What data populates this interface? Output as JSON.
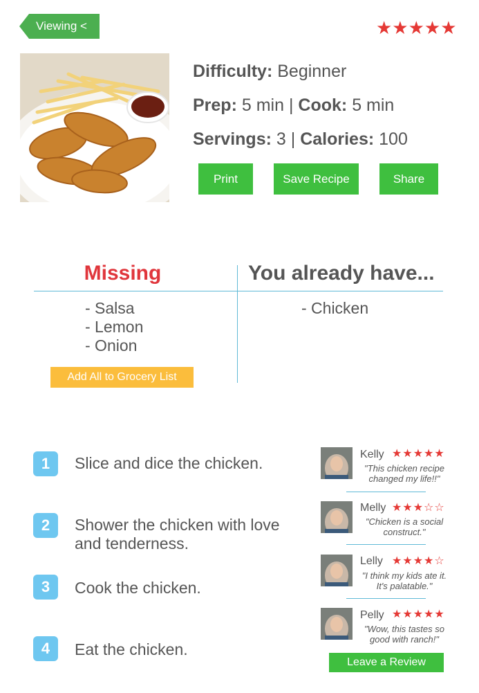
{
  "header": {
    "viewing_label": "Viewing <",
    "rating": "★★★★★"
  },
  "recipe": {
    "difficulty_label": "Difficulty:",
    "difficulty_value": "Beginner",
    "prep_label": "Prep:",
    "prep_value": "5 min",
    "cook_label": "Cook:",
    "cook_value": "5 min",
    "servings_label": "Servings:",
    "servings_value": "3",
    "calories_label": "Calories:",
    "calories_value": "100",
    "separator": "|"
  },
  "actions": {
    "print": "Print",
    "save": "Save Recipe",
    "share": "Share"
  },
  "ingredients": {
    "missing_heading": "Missing",
    "have_heading": "You already have...",
    "missing": [
      "- Salsa",
      "- Lemon",
      "- Onion"
    ],
    "have": [
      "- Chicken"
    ],
    "add_all_button": "Add All to Grocery List"
  },
  "steps": [
    {
      "num": "1",
      "text": "Slice and dice the chicken."
    },
    {
      "num": "2",
      "text": "Shower the chicken with love and tenderness."
    },
    {
      "num": "3",
      "text": "Cook the chicken."
    },
    {
      "num": "4",
      "text": "Eat the chicken."
    }
  ],
  "reviews": [
    {
      "name": "Kelly",
      "stars": "★★★★★",
      "text": "\"This chicken recipe changed my life!!\""
    },
    {
      "name": "Melly",
      "stars": "★★★☆☆",
      "text": "\"Chicken is a social construct.\""
    },
    {
      "name": "Lelly",
      "stars": "★★★★☆",
      "text": "\"I think my kids ate it. It's palatable.\""
    },
    {
      "name": "Pelly",
      "stars": "★★★★★",
      "text": "\"Wow, this tastes so good with ranch!\""
    }
  ],
  "leave_review_button": "Leave a Review",
  "colors": {
    "accent_green": "#3fbf3f",
    "missing_red": "#e0363c",
    "star_red": "#e53935",
    "step_blue": "#6ec7f0",
    "grocery_yellow": "#fbbd3c",
    "divider_blue": "#5fb9d6"
  },
  "icons": {
    "food_photo": "chicken-tenders-fries-photo",
    "avatar": "reviewer-avatar-photo"
  }
}
